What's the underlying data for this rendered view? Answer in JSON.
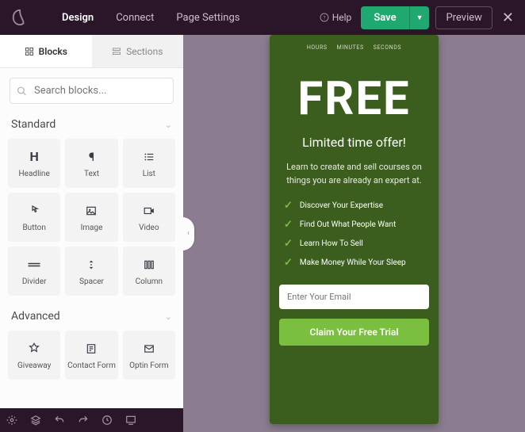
{
  "topbar": {
    "nav": [
      "Design",
      "Connect",
      "Page Settings"
    ],
    "help": "Help",
    "save": "Save",
    "preview": "Preview"
  },
  "sidebar": {
    "tabs": [
      "Blocks",
      "Sections"
    ],
    "search_placeholder": "Search blocks...",
    "standard_label": "Standard",
    "advanced_label": "Advanced",
    "standard": [
      {
        "label": "Headline"
      },
      {
        "label": "Text"
      },
      {
        "label": "List"
      },
      {
        "label": "Button"
      },
      {
        "label": "Image"
      },
      {
        "label": "Video"
      },
      {
        "label": "Divider"
      },
      {
        "label": "Spacer"
      },
      {
        "label": "Column"
      }
    ],
    "advanced": [
      {
        "label": "Giveaway"
      },
      {
        "label": "Contact Form"
      },
      {
        "label": "Optin Form"
      }
    ]
  },
  "canvas": {
    "timer": [
      "HOURS",
      "MINUTES",
      "SECONDS"
    ],
    "headline": "FREE",
    "subhead": "Limited time offer!",
    "desc": "Learn to create and sell courses on things you are already an expert at.",
    "bullets": [
      "Discover Your Expertise",
      "Find Out What People Want",
      "Learn How To Sell",
      "Make Money While Your Sleep"
    ],
    "email_placeholder": "Enter Your Email",
    "cta": "Claim Your Free Trial"
  }
}
